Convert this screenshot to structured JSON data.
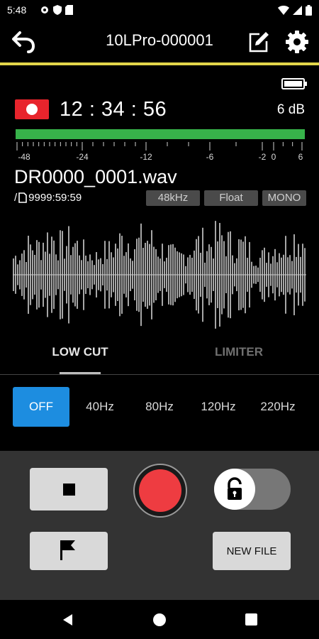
{
  "status_bar": {
    "time": "5:48"
  },
  "header": {
    "title": "10LPro-000001"
  },
  "recorder": {
    "time": "12 : 34 : 56",
    "level": "6 dB",
    "meter_scale": [
      "-48",
      "-24",
      "-12",
      "-6",
      "-2",
      "0",
      "6"
    ],
    "meter_level_fraction": 1.0
  },
  "file": {
    "name": "DR0000_0001.wav",
    "remaining_prefix": "/",
    "remaining": "9999:59:59",
    "sample_rate": "48kHz",
    "bit_depth": "Float",
    "channels": "MONO"
  },
  "tabs": [
    {
      "label": "LOW CUT",
      "active": true
    },
    {
      "label": "LIMITER",
      "active": false
    }
  ],
  "low_cut": {
    "options": [
      "OFF",
      "40Hz",
      "80Hz",
      "120Hz",
      "220Hz"
    ],
    "selected": "OFF"
  },
  "controls": {
    "new_file_label": "NEW FILE",
    "lock_state": "unlocked"
  },
  "colors": {
    "accent_yellow": "#e2d64a",
    "meter_green": "#37b34a",
    "record_red": "#ee3c41",
    "selected_blue": "#1d8de0"
  },
  "icons": {
    "back": "back-arrow-icon",
    "edit": "edit-icon",
    "settings": "gear-icon",
    "battery": "battery-icon",
    "mark": "flag-icon",
    "lock": "unlocked-padlock-icon"
  }
}
